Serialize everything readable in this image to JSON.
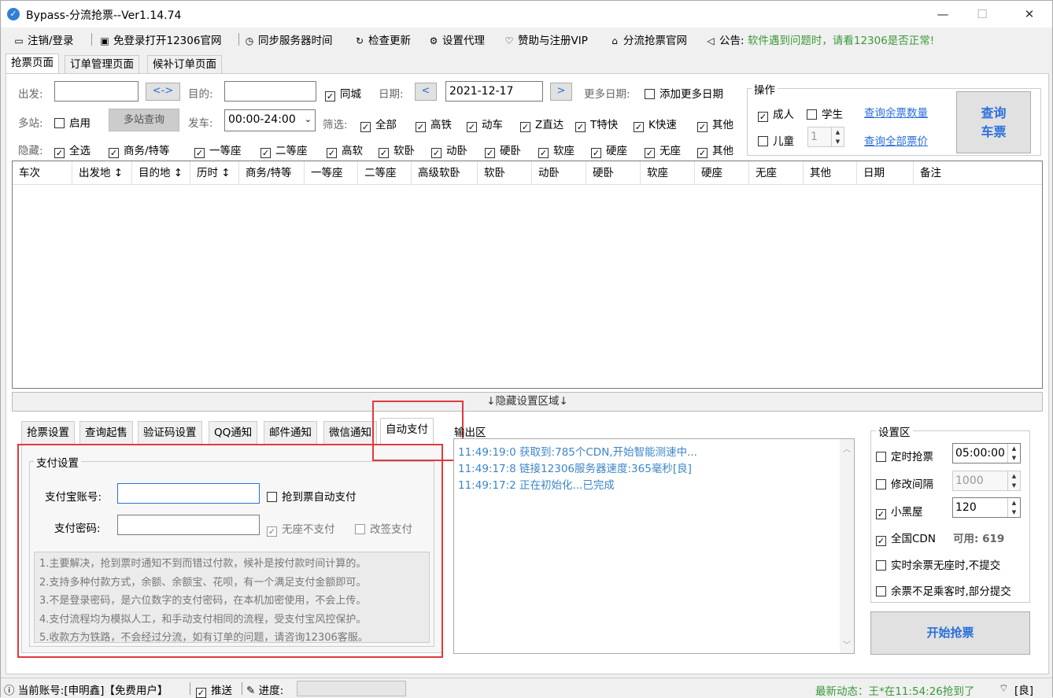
{
  "title": "Bypass-分流抢票--Ver1.14.74",
  "menu": {
    "logout": "注销/登录",
    "open_12306": "免登录打开12306官网",
    "sync_time": "同步服务器时间",
    "check_update": "检查更新",
    "proxy": "设置代理",
    "vip": "赞助与注册VIP",
    "official": "分流抢票官网",
    "notice_label": "公告:",
    "notice_text": "软件遇到问题时，请看12306是否正常!"
  },
  "tabs": [
    "抢票页面",
    "订单管理页面",
    "候补订单页面"
  ],
  "query": {
    "from_label": "出发:",
    "swap": "<->",
    "to_label": "目的:",
    "same_city": "同城",
    "date_label": "日期:",
    "date_value": "2021-12-17",
    "prev": "<",
    "next": ">",
    "more_dates_label": "更多日期:",
    "add_dates": "添加更多日期",
    "multi_label": "多站:",
    "enable": "启用",
    "multi_query": "多站查询",
    "depart_label": "发车:",
    "depart_value": "00:00-24:00",
    "filter_label": "筛选:",
    "filters": [
      "全部",
      "高铁",
      "动车",
      "Z直达",
      "T特快",
      "K快速",
      "其他"
    ],
    "hide_label": "隐藏:",
    "hides": [
      "全选",
      "商务/特等",
      "一等座",
      "二等座",
      "高软",
      "软卧",
      "动卧",
      "硬卧",
      "软座",
      "硬座",
      "无座",
      "其他"
    ]
  },
  "ops": {
    "title": "操作",
    "adult": "成人",
    "student": "学生",
    "child": "儿童",
    "child_count": "1",
    "query_count": "查询余票数量",
    "query_price": "查询全部票价",
    "query_btn_line1": "查询",
    "query_btn_line2": "车票"
  },
  "columns": [
    "车次",
    "出发地 ↕",
    "目的地 ↕",
    "历时 ↕",
    "商务/特等",
    "一等座",
    "二等座",
    "高级软卧",
    "软卧",
    "动卧",
    "硬卧",
    "软座",
    "硬座",
    "无座",
    "其他",
    "日期",
    "备注"
  ],
  "hide_area": "↓隐藏设置区域↓",
  "settings_tabs": [
    "抢票设置",
    "查询起售",
    "验证码设置",
    "QQ通知",
    "邮件通知",
    "微信通知",
    "自动支付"
  ],
  "payment": {
    "title": "支付设置",
    "account_label": "支付宝账号:",
    "password_label": "支付密码:",
    "auto_pay": "抢到票自动支付",
    "no_seat_no_pay": "无座不支付",
    "change_pay": "改签支付",
    "notes": [
      "1.主要解决，抢到票时通知不到而错过付款，候补是按付款时间计算的。",
      "2.支持多种付款方式，余额、余额宝、花呗，有一个满足支付金额即可。",
      "3.不是登录密码，是六位数字的支付密码，在本机加密使用，不会上传。",
      "4.支付流程均为模拟人工，和手动支付相同的流程，受支付宝风控保护。",
      "5.收款方为铁路，不会经过分流，如有订单的问题，请咨询12306客服。"
    ]
  },
  "output": {
    "title": "输出区",
    "lines": [
      "11:49:19:0  获取到:785个CDN,开始智能测速中...",
      "11:49:17:8  链接12306服务器速度:365毫秒[良]",
      "11:49:17:2  正在初始化...已完成"
    ]
  },
  "settings": {
    "title": "设置区",
    "timed": "定时抢票",
    "timed_value": "05:00:00",
    "interval": "修改间隔",
    "interval_value": "1000",
    "blackroom": "小黑屋",
    "blackroom_value": "120",
    "cdn": "全国CDN",
    "cdn_available_label": "可用:",
    "cdn_available": "619",
    "realtime": "实时余票无座时,不提交",
    "partial": "余票不足乘客时,部分提交",
    "start": "开始抢票"
  },
  "status": {
    "account": "当前账号:[申明鑫]【免费用户】",
    "push": "推送",
    "progress": "进度:",
    "latest": "最新动态：王*在11:54:26抢到了",
    "signal": "[良]"
  },
  "colors": {
    "accent": "#2a6fdb",
    "notice": "#3a9a3a",
    "highlight": "#e0393e",
    "output_text": "#3b86c8"
  }
}
